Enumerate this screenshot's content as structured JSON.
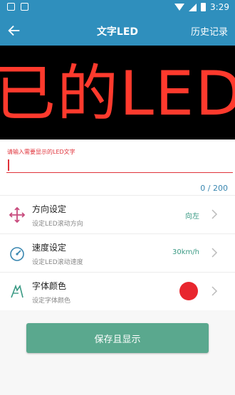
{
  "status_bar": {
    "time": "3:29"
  },
  "app_bar": {
    "title": "文字LED",
    "history_label": "历史记录"
  },
  "led_preview": {
    "text": "已的LED",
    "color": "#ff3a2d",
    "background": "#000000"
  },
  "input": {
    "label": "请输入需要显示的LED文字",
    "value": "",
    "placeholder": "",
    "counter": "0 / 200"
  },
  "settings": [
    {
      "title": "方向设定",
      "subtitle": "设定LED滚动方向",
      "value": "向左",
      "icon": "direction-arrows-icon"
    },
    {
      "title": "速度设定",
      "subtitle": "设定LED滚动速度",
      "value": "30km/h",
      "icon": "speedometer-icon"
    },
    {
      "title": "字体颜色",
      "subtitle": "设定字体颜色",
      "value_color": "#e8262e",
      "icon": "font-color-icon"
    }
  ],
  "save_button": {
    "label": "保存且显示"
  },
  "colors": {
    "accent": "#2f8fbd",
    "button": "#5aa88e",
    "error": "#e0323a"
  }
}
